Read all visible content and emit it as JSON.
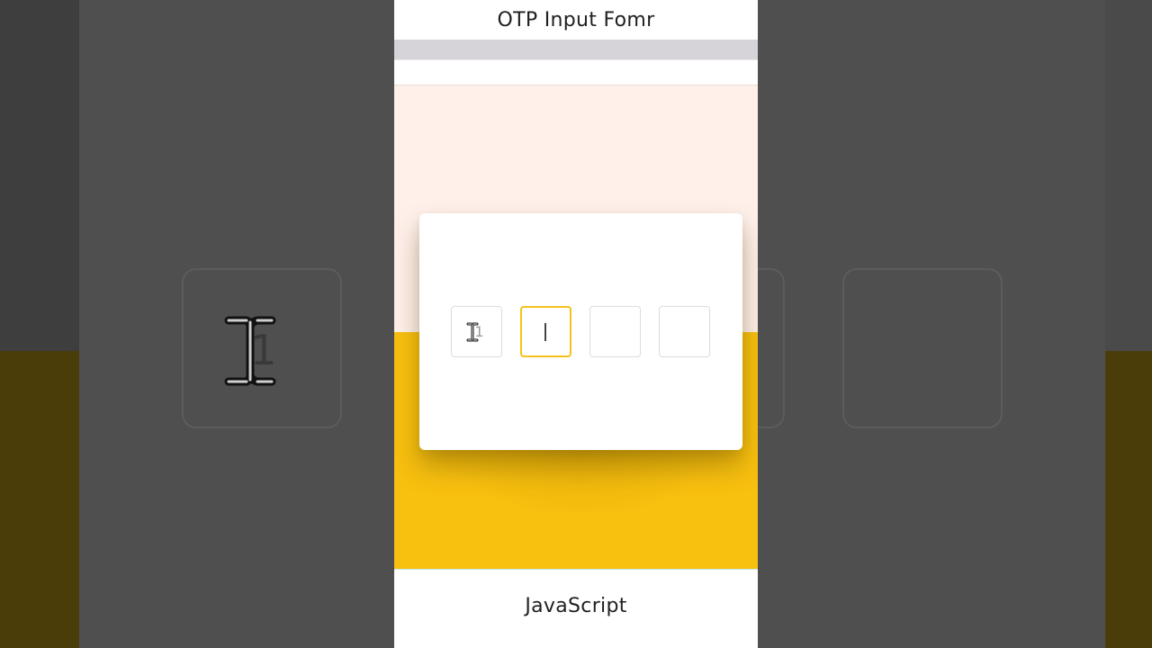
{
  "header": {
    "title": "OTP Input Fomr"
  },
  "otp": {
    "digits": [
      "1",
      "",
      "",
      ""
    ],
    "active_index": 1
  },
  "footer": {
    "label": "JavaScript"
  },
  "background": {
    "digit": "1"
  },
  "icons": {
    "cursor": "text-cursor-icon"
  },
  "colors": {
    "accent": "#f4c21a",
    "scene_top": "#fff0ea",
    "scene_bottom": "#f8c00f",
    "backdrop": "#4d4d4d"
  }
}
